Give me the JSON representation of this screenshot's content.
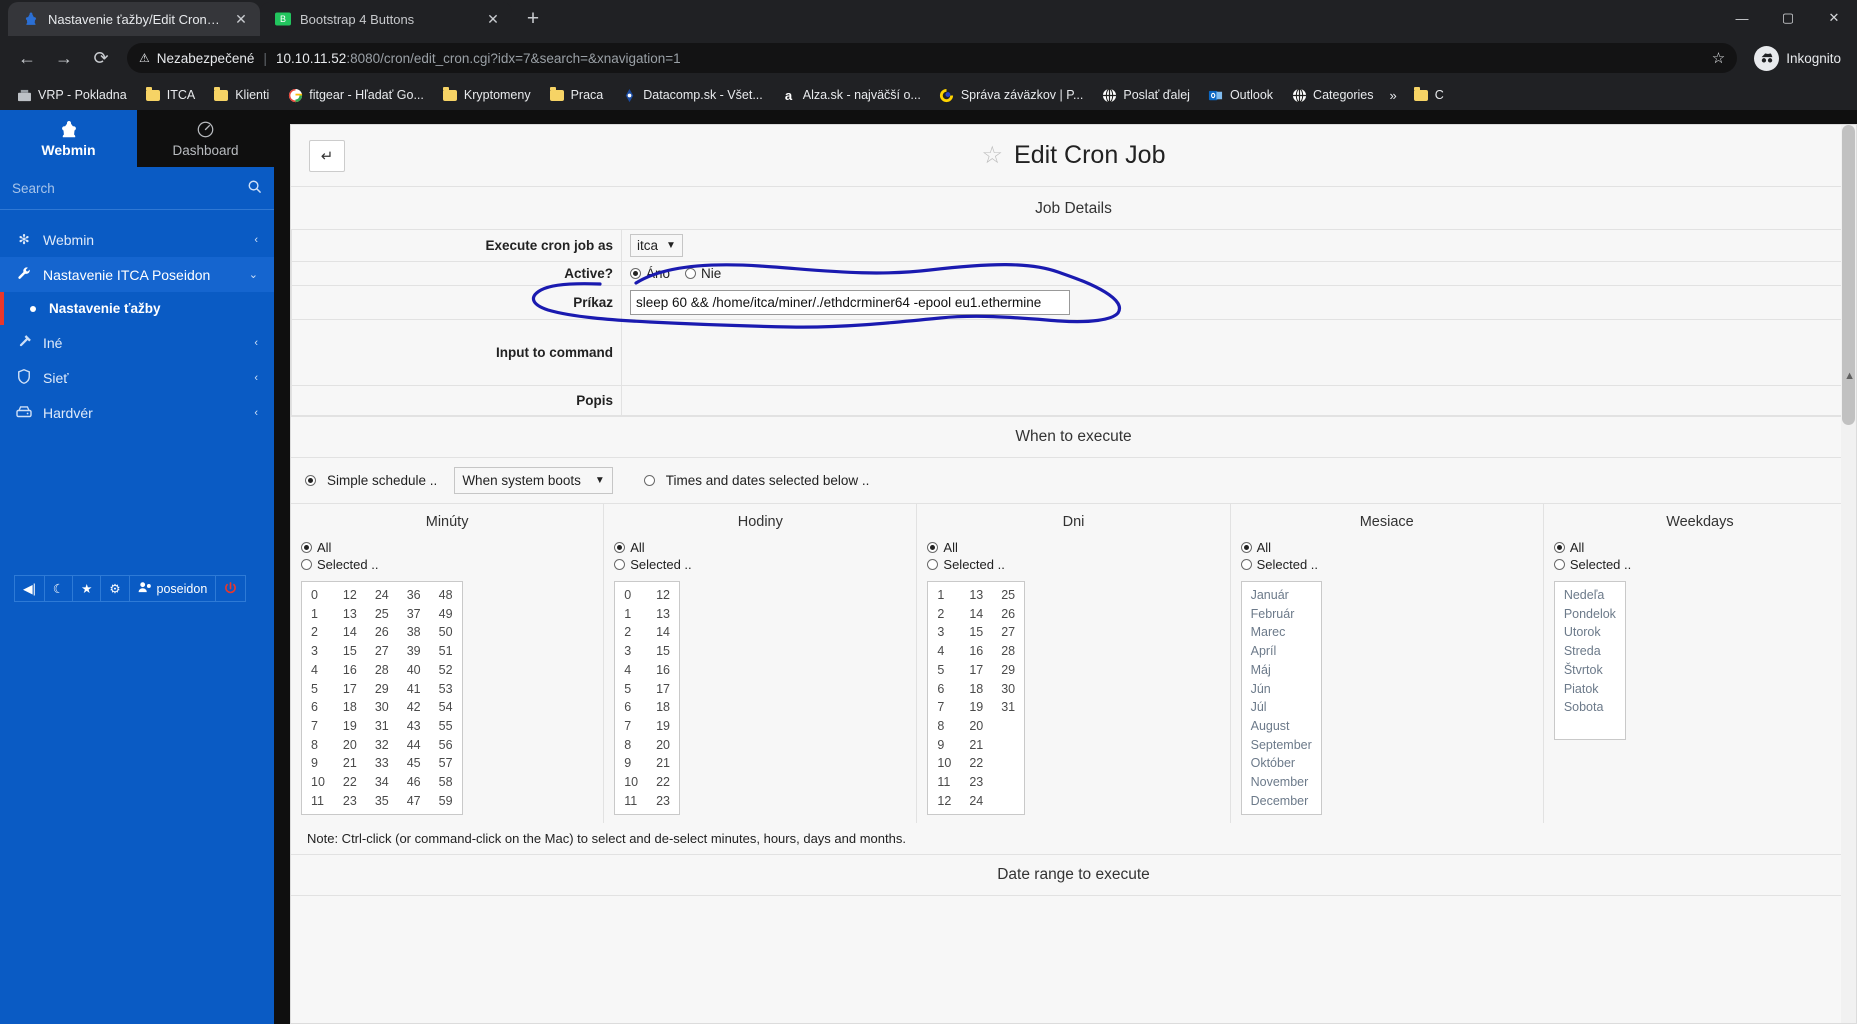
{
  "browser": {
    "tabs": [
      {
        "title": "Nastavenie ťažby/Edit Cron Job -",
        "icon": "webmin-favicon",
        "active": true,
        "close": "✕"
      },
      {
        "title": "Bootstrap 4 Buttons",
        "icon": "bootstrap-favicon",
        "active": false,
        "close": "✕"
      }
    ],
    "newtab_label": "+",
    "window_controls": {
      "minimize": "—",
      "maximize": "▢",
      "close": "✕"
    },
    "nav": {
      "back": "←",
      "forward": "→",
      "reload": "⟳"
    },
    "omnibox": {
      "warning_icon": "⚠",
      "security_label": "Nezabezpečené",
      "divider": "|",
      "url_host": "10.10.11.52",
      "url_rest": ":8080/cron/edit_cron.cgi?idx=7&search=&xnavigation=1",
      "star": "☆"
    },
    "profile": {
      "label": "Inkognito",
      "icon": "incognito-icon"
    },
    "bookmarks": [
      {
        "label": "VRP - Pokladna",
        "icon": "site-icon"
      },
      {
        "label": "ITCA",
        "icon": "folder-icon"
      },
      {
        "label": "Klienti",
        "icon": "folder-icon"
      },
      {
        "label": "fitgear - Hľadať Go...",
        "icon": "google-icon"
      },
      {
        "label": "Kryptomeny",
        "icon": "folder-icon"
      },
      {
        "label": "Praca",
        "icon": "folder-icon"
      },
      {
        "label": "Datacomp.sk - Všet...",
        "icon": "datacomp-icon"
      },
      {
        "label": "Alza.sk - najväčší o...",
        "icon": "alza-icon"
      },
      {
        "label": "Správa záväzkov | P...",
        "icon": "pohoda-icon"
      },
      {
        "label": "Poslať ďalej",
        "icon": "globe-icon"
      },
      {
        "label": "Outlook",
        "icon": "outlook-icon"
      },
      {
        "label": "Categories",
        "icon": "globe-icon"
      }
    ],
    "bookmarks_overflow": "»",
    "bookmark_trailing": {
      "label": "C",
      "icon": "folder-icon"
    }
  },
  "sidebar": {
    "brand": {
      "label": "Webmin",
      "icon": "webmin-logo-icon"
    },
    "dashboard": {
      "label": "Dashboard",
      "icon": "gauge-icon"
    },
    "search": {
      "placeholder": "Search",
      "icon": "search-icon"
    },
    "items": [
      {
        "label": "Webmin",
        "icon": "gear-icon",
        "chevron": "‹",
        "selected": false
      },
      {
        "label": "Nastavenie ITCA Poseidon",
        "icon": "wrench-icon",
        "chevron": "⌄",
        "selected": true
      },
      {
        "label": "Iné",
        "icon": "hammer-icon",
        "chevron": "‹",
        "selected": false
      },
      {
        "label": "Sieť",
        "icon": "shield-icon",
        "chevron": "‹",
        "selected": false
      },
      {
        "label": "Hardvér",
        "icon": "drive-icon",
        "chevron": "‹",
        "selected": false
      }
    ],
    "subitem": {
      "label": "Nastavenie ťažby"
    },
    "tools": [
      {
        "name": "collapse-sidebar-button",
        "icon": "◀|"
      },
      {
        "name": "theme-toggle-button",
        "icon": "☾"
      },
      {
        "name": "favorites-button",
        "icon": "★"
      },
      {
        "name": "theme-config-button",
        "icon": "⚙"
      },
      {
        "name": "user-button",
        "icon": "👤",
        "label": "poseidon"
      },
      {
        "name": "logout-button",
        "icon": "⏻"
      }
    ]
  },
  "content": {
    "back_button": "↵",
    "title": "Edit Cron Job",
    "title_star": "☆",
    "section_job_details": "Job Details",
    "fields": {
      "execute_as_label": "Execute cron job as",
      "execute_as_value": "itca",
      "active_label": "Active?",
      "active_yes": "Áno",
      "active_no": "Nie",
      "active_selected": "yes",
      "command_label": "Príkaz",
      "command_value": "sleep 60 && /home/itca/miner/./ethdcrminer64 -epool eu1.ethermine",
      "input_label": "Input to command",
      "input_value": "",
      "popis_label": "Popis",
      "popis_value": ""
    },
    "section_when_to_execute": "When to execute",
    "schedule": {
      "simple_label": "Simple schedule ..",
      "simple_selected": true,
      "boot_value": "When system boots",
      "times_label": "Times and dates selected below ..",
      "times_selected": false
    },
    "grids": [
      {
        "title": "Minúty",
        "all_label": "All",
        "selected_label": "Selected ..",
        "all_checked": true,
        "columns": [
          [
            "0",
            "1",
            "2",
            "3",
            "4",
            "5",
            "6",
            "7",
            "8",
            "9",
            "10",
            "11"
          ],
          [
            "12",
            "13",
            "14",
            "15",
            "16",
            "17",
            "18",
            "19",
            "20",
            "21",
            "22",
            "23"
          ],
          [
            "24",
            "25",
            "26",
            "27",
            "28",
            "29",
            "30",
            "31",
            "32",
            "33",
            "34",
            "35"
          ],
          [
            "36",
            "37",
            "38",
            "39",
            "40",
            "41",
            "42",
            "43",
            "44",
            "45",
            "46",
            "47"
          ],
          [
            "48",
            "49",
            "50",
            "51",
            "52",
            "53",
            "54",
            "55",
            "56",
            "57",
            "58",
            "59"
          ]
        ],
        "muted": false
      },
      {
        "title": "Hodiny",
        "all_label": "All",
        "selected_label": "Selected ..",
        "all_checked": true,
        "columns": [
          [
            "0",
            "1",
            "2",
            "3",
            "4",
            "5",
            "6",
            "7",
            "8",
            "9",
            "10",
            "11"
          ],
          [
            "12",
            "13",
            "14",
            "15",
            "16",
            "17",
            "18",
            "19",
            "20",
            "21",
            "22",
            "23"
          ]
        ],
        "muted": false
      },
      {
        "title": "Dni",
        "all_label": "All",
        "selected_label": "Selected ..",
        "all_checked": true,
        "columns": [
          [
            "1",
            "2",
            "3",
            "4",
            "5",
            "6",
            "7",
            "8",
            "9",
            "10",
            "11",
            "12"
          ],
          [
            "13",
            "14",
            "15",
            "16",
            "17",
            "18",
            "19",
            "20",
            "21",
            "22",
            "23",
            "24"
          ],
          [
            "25",
            "26",
            "27",
            "28",
            "29",
            "30",
            "31"
          ]
        ],
        "muted": false
      },
      {
        "title": "Mesiace",
        "all_label": "All",
        "selected_label": "Selected ..",
        "all_checked": true,
        "columns": [
          [
            "Január",
            "Február",
            "Marec",
            "Apríl",
            "Máj",
            "Jún",
            "Júl",
            "August",
            "September",
            "Október",
            "November",
            "December"
          ]
        ],
        "muted": true
      },
      {
        "title": "Weekdays",
        "all_label": "All",
        "selected_label": "Selected ..",
        "all_checked": true,
        "columns": [
          [
            "Nedeľa",
            "Pondelok",
            "Utorok",
            "Streda",
            "Štvrtok",
            "Piatok",
            "Sobota"
          ]
        ],
        "muted": true
      }
    ],
    "note": "Note: Ctrl-click (or command-click on the Mac) to select and de-select minutes, hours, days and months.",
    "section_date_range": "Date range to execute"
  },
  "colors": {
    "sidebar_bg": "#0a5bc4",
    "sidebar_sel": "#1565cf",
    "chrome_bg": "#202124",
    "annotation": "#1a1ab0",
    "accent_red": "#e8372c"
  }
}
